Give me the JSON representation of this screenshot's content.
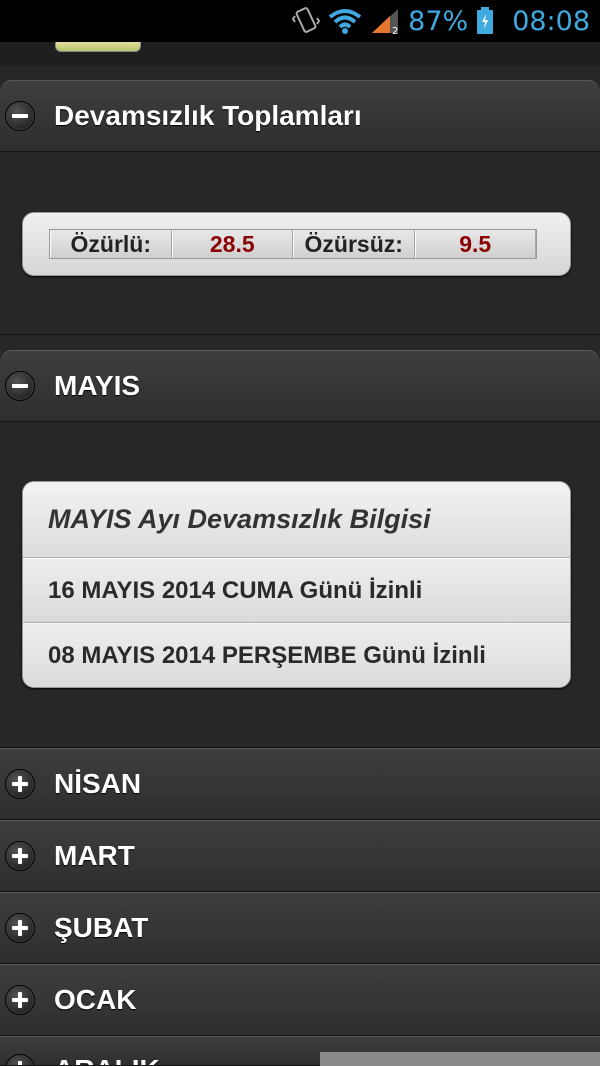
{
  "status_bar": {
    "battery_percent": "87%",
    "time": "08:08",
    "icons": [
      "vibrate-icon",
      "wifi-icon",
      "signal-icon",
      "battery-icon"
    ],
    "accent_color": "#3fa9e0"
  },
  "totals": {
    "header": "Devamsızlık Toplamları",
    "excused_label": "Özürlü:",
    "excused_value": "28.5",
    "unexcused_label": "Özürsüz:",
    "unexcused_value": "9.5"
  },
  "may": {
    "header": "MAYIS",
    "card_title": "MAYIS Ayı Devamsızlık Bilgisi",
    "items": [
      "16 MAYIS 2014 CUMA Günü İzinli",
      "08 MAYIS 2014 PERŞEMBE Günü İzinli"
    ]
  },
  "months": [
    {
      "label": "NİSAN",
      "expanded": false
    },
    {
      "label": "MART",
      "expanded": false
    },
    {
      "label": "ŞUBAT",
      "expanded": false
    },
    {
      "label": "OCAK",
      "expanded": false
    },
    {
      "label": "ARALIK",
      "expanded": false
    }
  ]
}
